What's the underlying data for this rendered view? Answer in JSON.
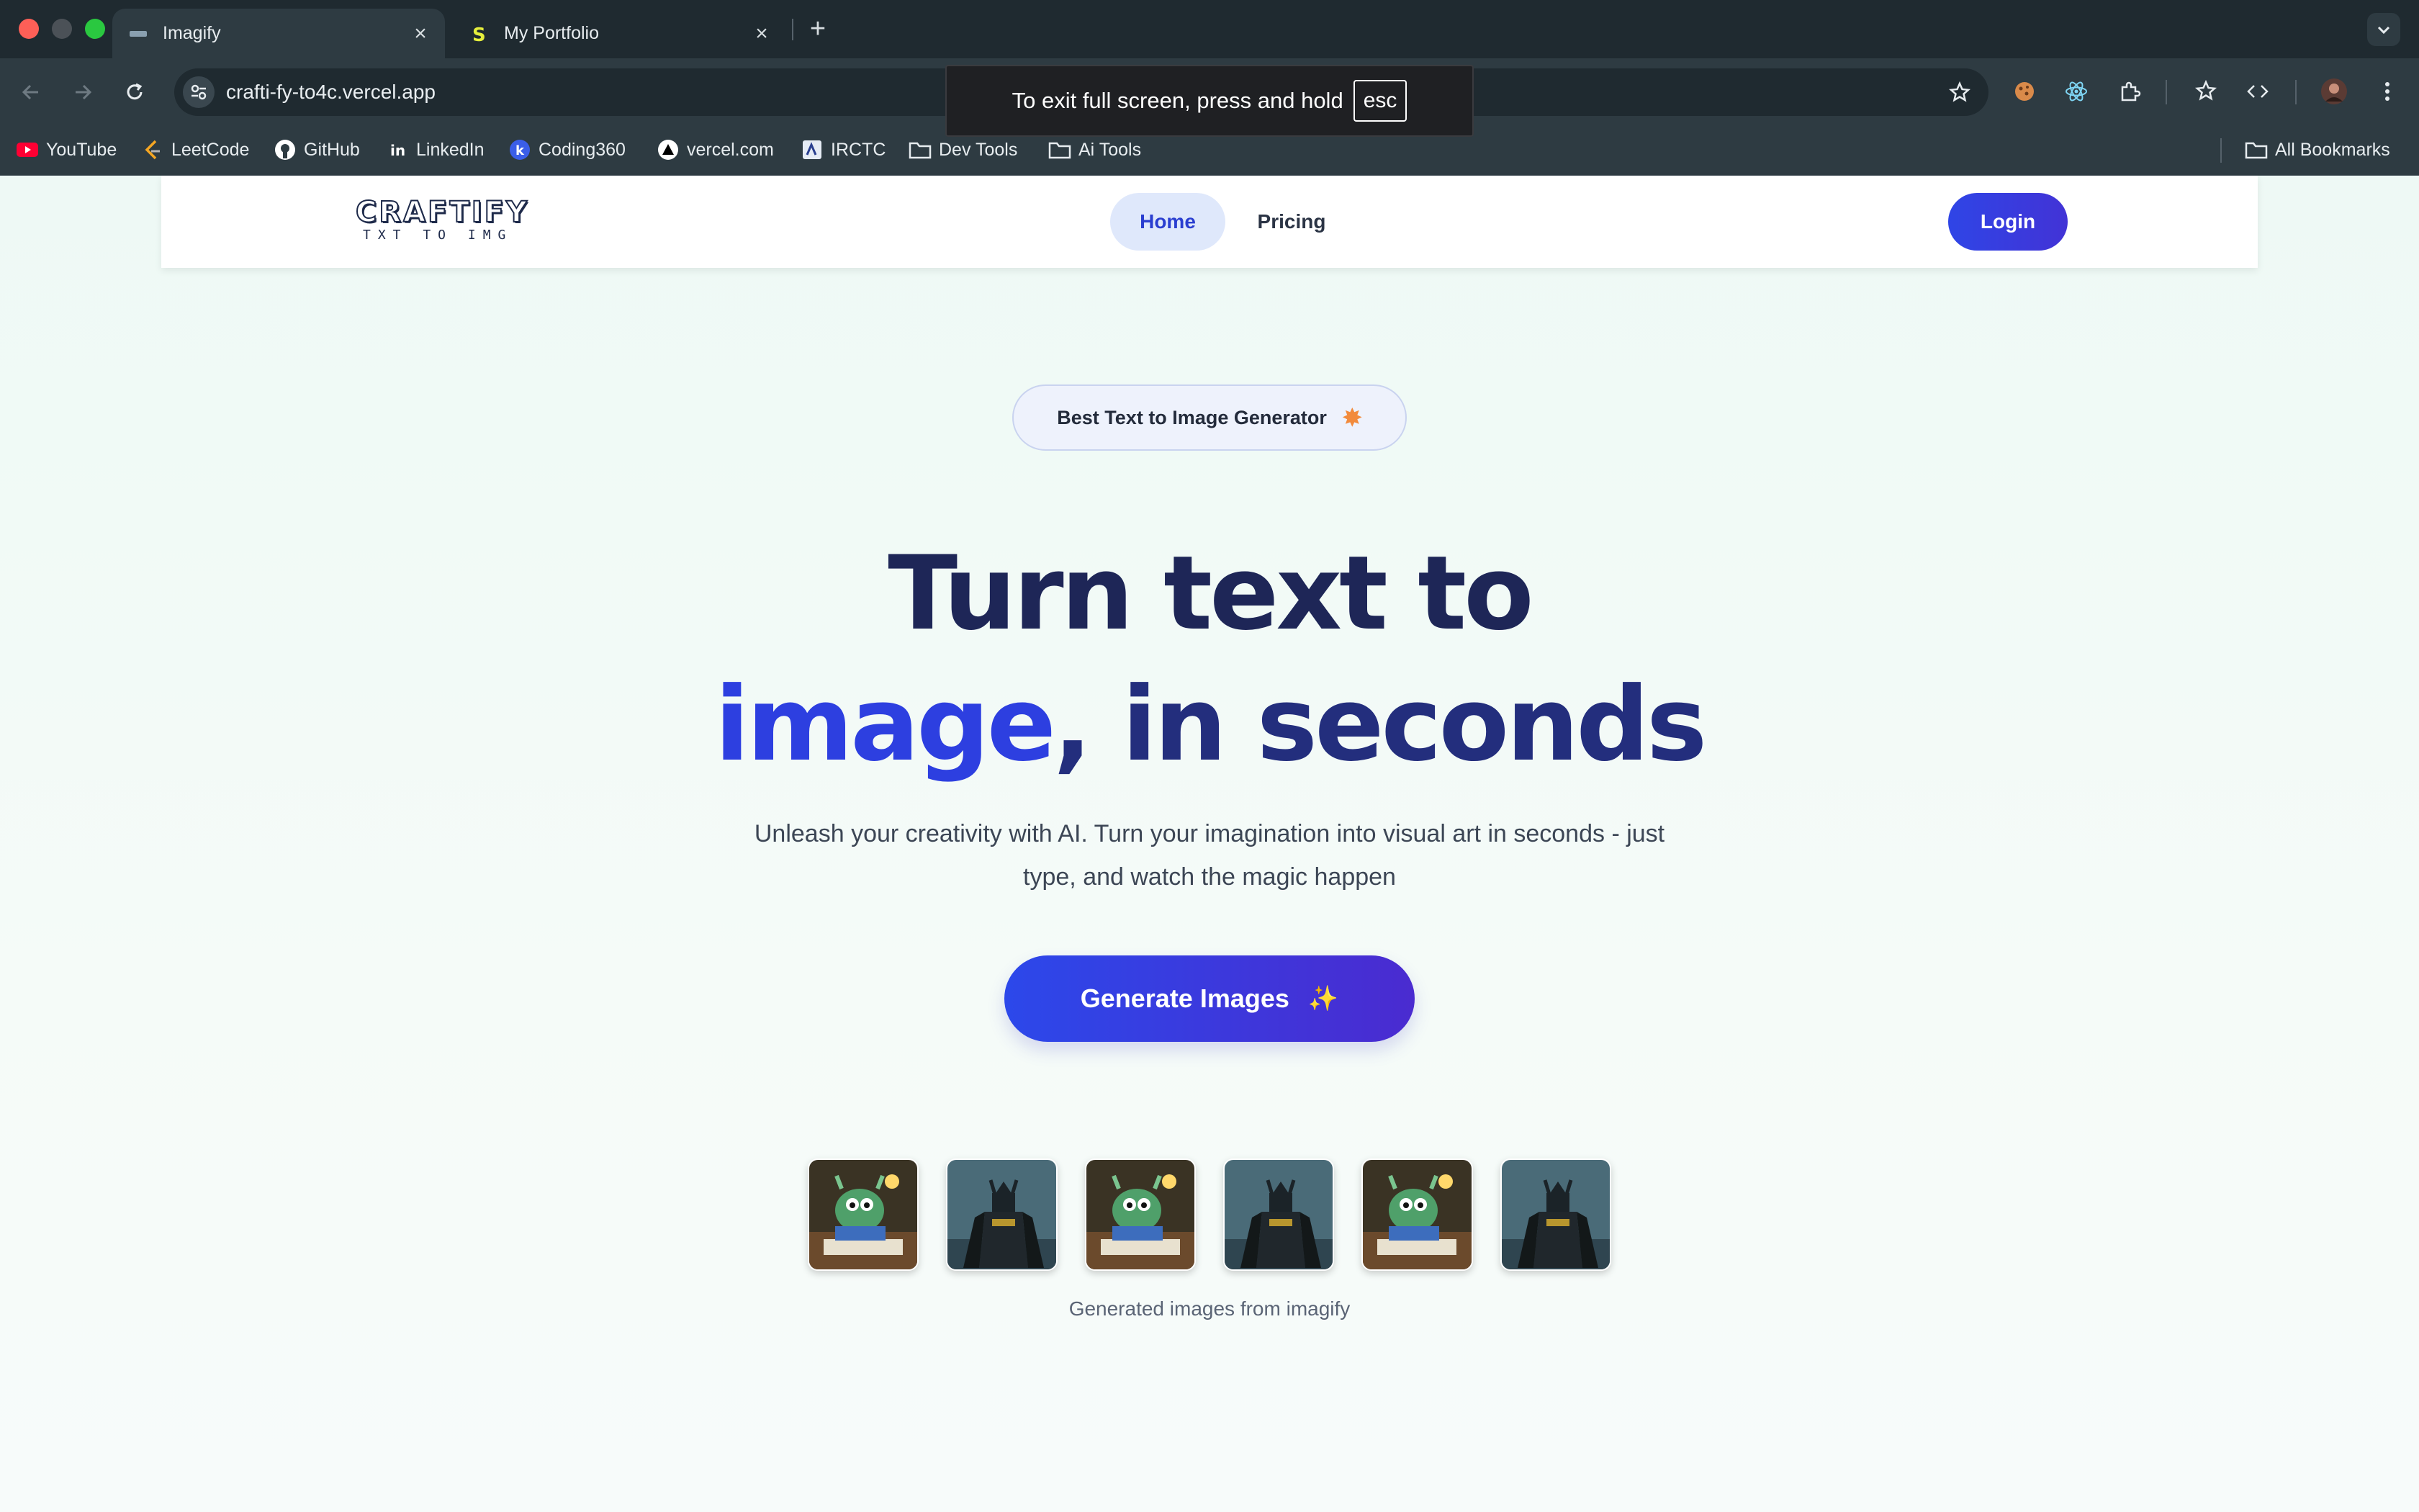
{
  "browser": {
    "tabs": [
      {
        "title": "Imagify",
        "active": true,
        "icon": "site-favicon"
      },
      {
        "title": "My Portfolio",
        "active": false,
        "icon": "s-favicon"
      }
    ],
    "url": "crafti-fy-to4c.vercel.app",
    "bookmarks": [
      {
        "label": "YouTube",
        "icon": "youtube-icon"
      },
      {
        "label": "LeetCode",
        "icon": "leetcode-icon"
      },
      {
        "label": "GitHub",
        "icon": "github-icon"
      },
      {
        "label": "LinkedIn",
        "icon": "linkedin-icon"
      },
      {
        "label": "Coding360",
        "icon": "coding360-icon"
      },
      {
        "label": "vercel.com",
        "icon": "vercel-icon"
      },
      {
        "label": "IRCTC",
        "icon": "irctc-icon"
      },
      {
        "label": "Dev Tools",
        "icon": "folder-icon"
      },
      {
        "label": "Ai Tools",
        "icon": "folder-icon"
      }
    ],
    "all_bookmarks": "All Bookmarks",
    "fullscreen_notice": {
      "text": "To exit full screen, press and hold",
      "key": "esc"
    }
  },
  "site": {
    "logo": {
      "main": "CRAFTIFY",
      "sub": "TXT TO IMG"
    },
    "nav": {
      "home": "Home",
      "pricing": "Pricing",
      "login": "Login"
    },
    "badge": "Best Text to Image Generator",
    "hero": {
      "line1": "Turn text to",
      "accent": "image",
      "line2_rest": ", in seconds"
    },
    "subtext": "Unleash your creativity with AI. Turn your imagination into visual art in seconds - just type, and watch the magic happen",
    "cta": "Generate Images",
    "gallery": [
      "monster",
      "batman",
      "monster",
      "batman",
      "monster",
      "batman"
    ],
    "caption": "Generated images from imagify"
  },
  "colors": {
    "primary": "#2d3fe0",
    "heading": "#1e2657",
    "background": "#f4fbf8"
  }
}
